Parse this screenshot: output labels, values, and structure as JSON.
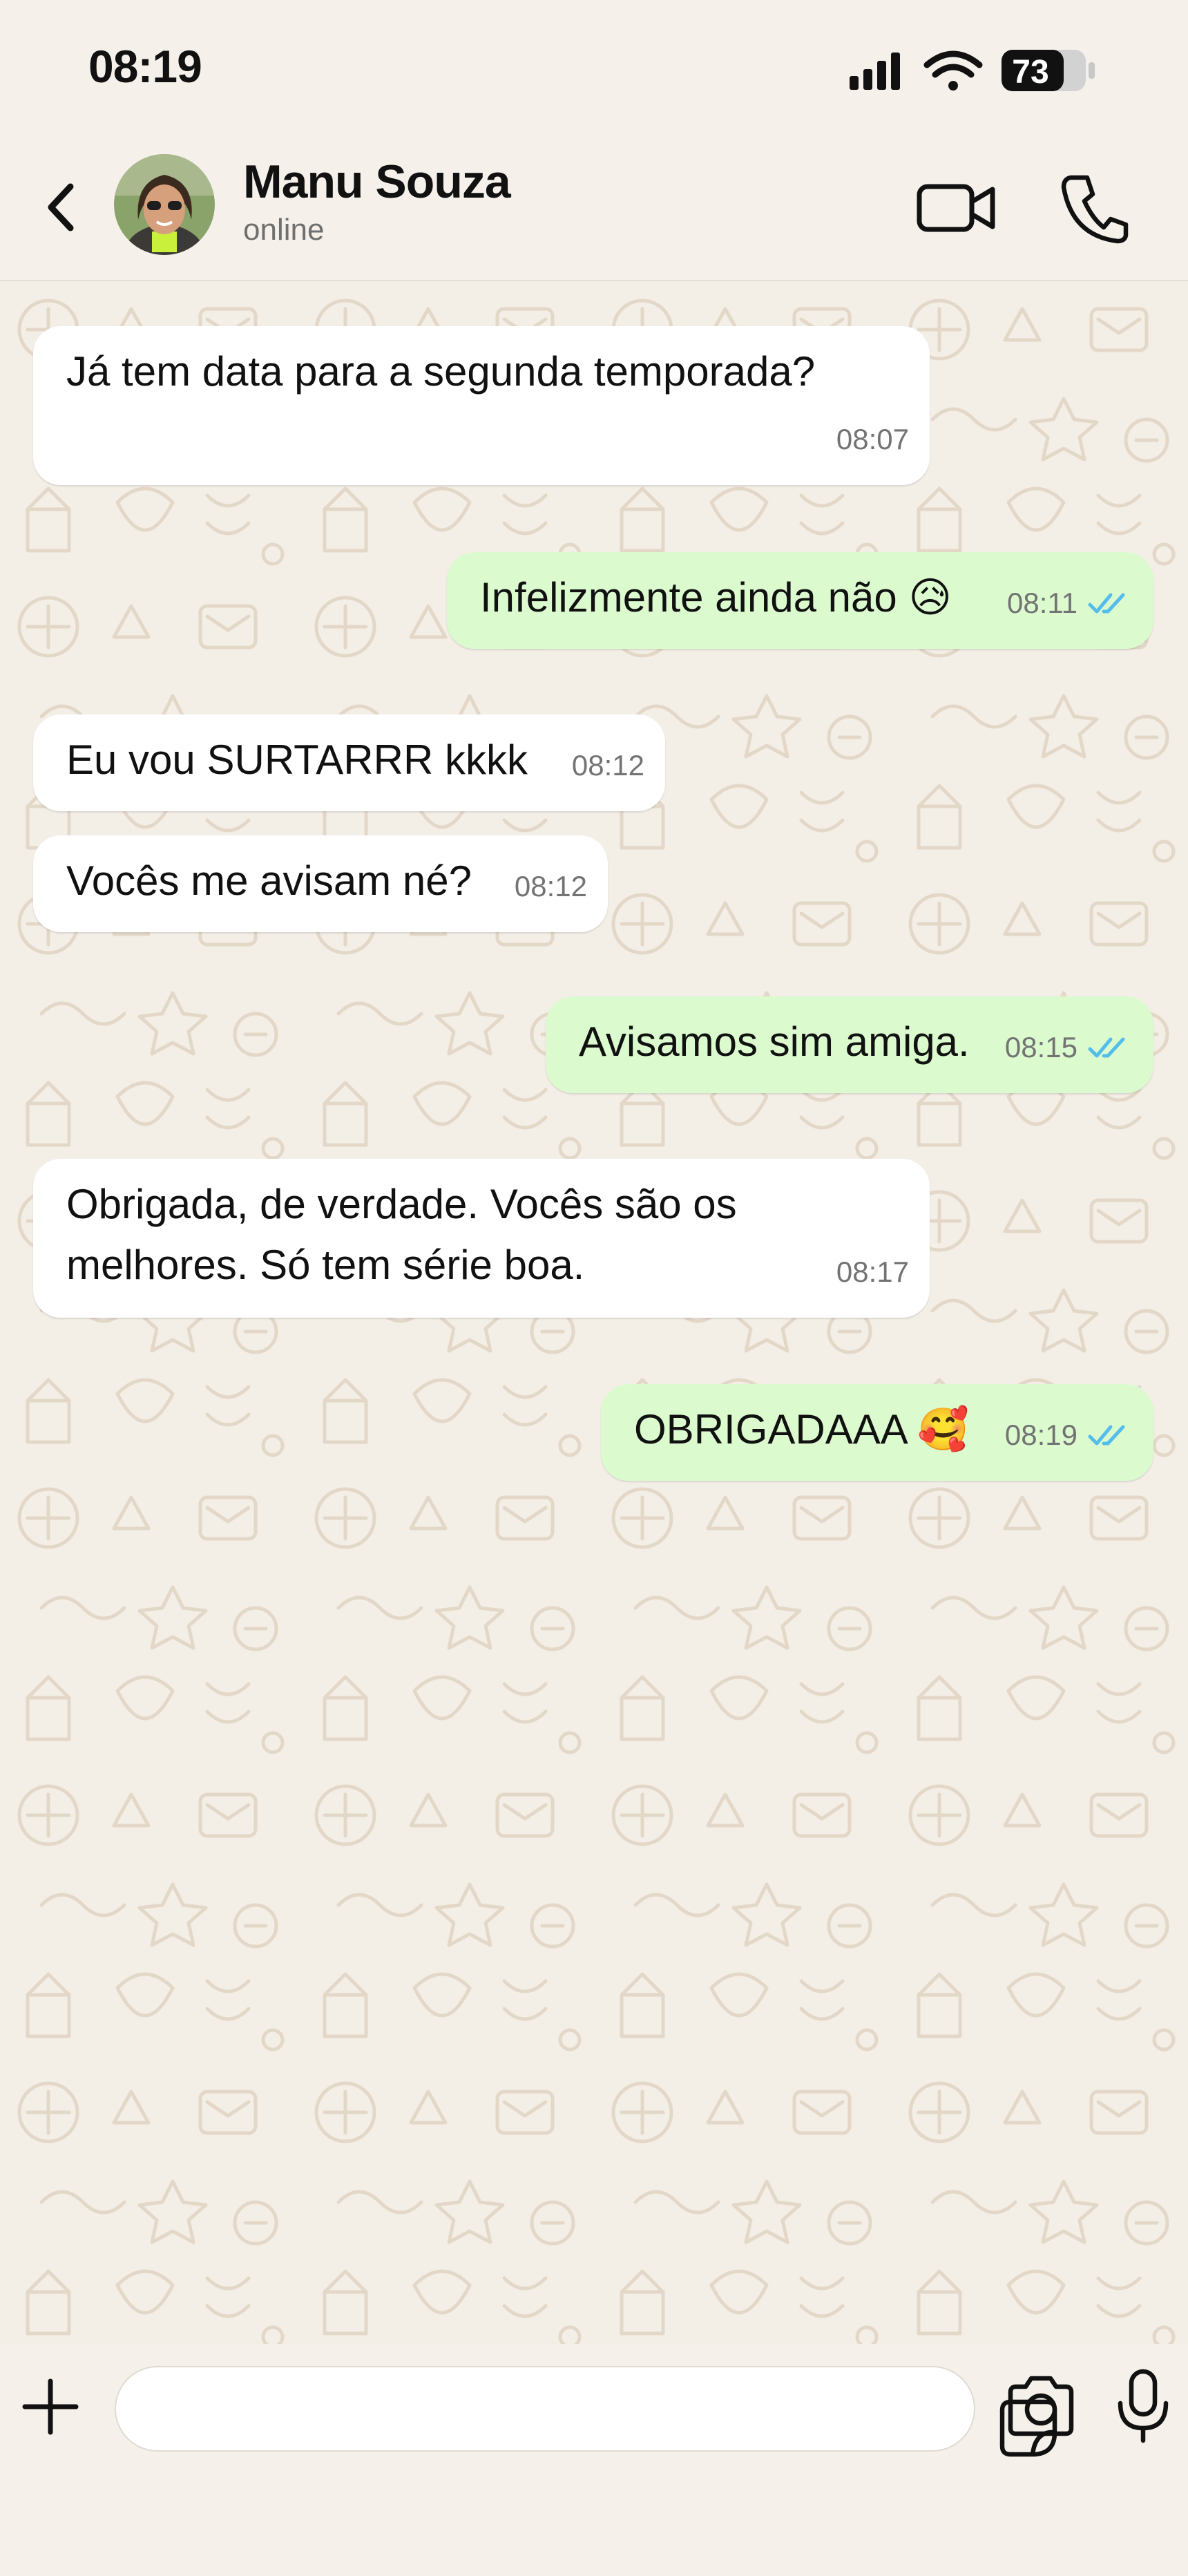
{
  "status_bar": {
    "time": "08:19",
    "battery": "73"
  },
  "header": {
    "back_icon": "chevron-left-icon",
    "contact_name": "Manu Souza",
    "contact_status": "online",
    "video_icon": "video-camera-icon",
    "call_icon": "phone-icon"
  },
  "messages": [
    {
      "direction": "incoming",
      "text": "Já tem data para a segunda temporada?",
      "time": "08:07"
    },
    {
      "direction": "outgoing",
      "text": "Infelizmente ainda não 😥",
      "time": "08:11",
      "read": true
    },
    {
      "direction": "incoming",
      "text": "Eu vou SURTARRR kkkk",
      "time": "08:12"
    },
    {
      "direction": "incoming",
      "text": "Vocês me avisam né?",
      "time": "08:12"
    },
    {
      "direction": "outgoing",
      "text": "Avisamos sim amiga.",
      "time": "08:15",
      "read": true
    },
    {
      "direction": "incoming",
      "text": "Obrigada, de verdade. Vocês são os melhores. Só tem série boa.",
      "time": "08:17"
    },
    {
      "direction": "outgoing",
      "text": "OBRIGADAAA 🥰",
      "time": "08:19",
      "read": true
    }
  ],
  "composer": {
    "value": "",
    "placeholder": "",
    "plus_icon": "plus-icon",
    "sticker_icon": "sticker-icon",
    "camera_icon": "camera-icon",
    "mic_icon": "microphone-icon"
  },
  "colors": {
    "incoming_bubble": "#ffffff",
    "outgoing_bubble": "#dbfbcf",
    "read_ticks": "#53bdeb",
    "background": "#f5f1ea"
  }
}
